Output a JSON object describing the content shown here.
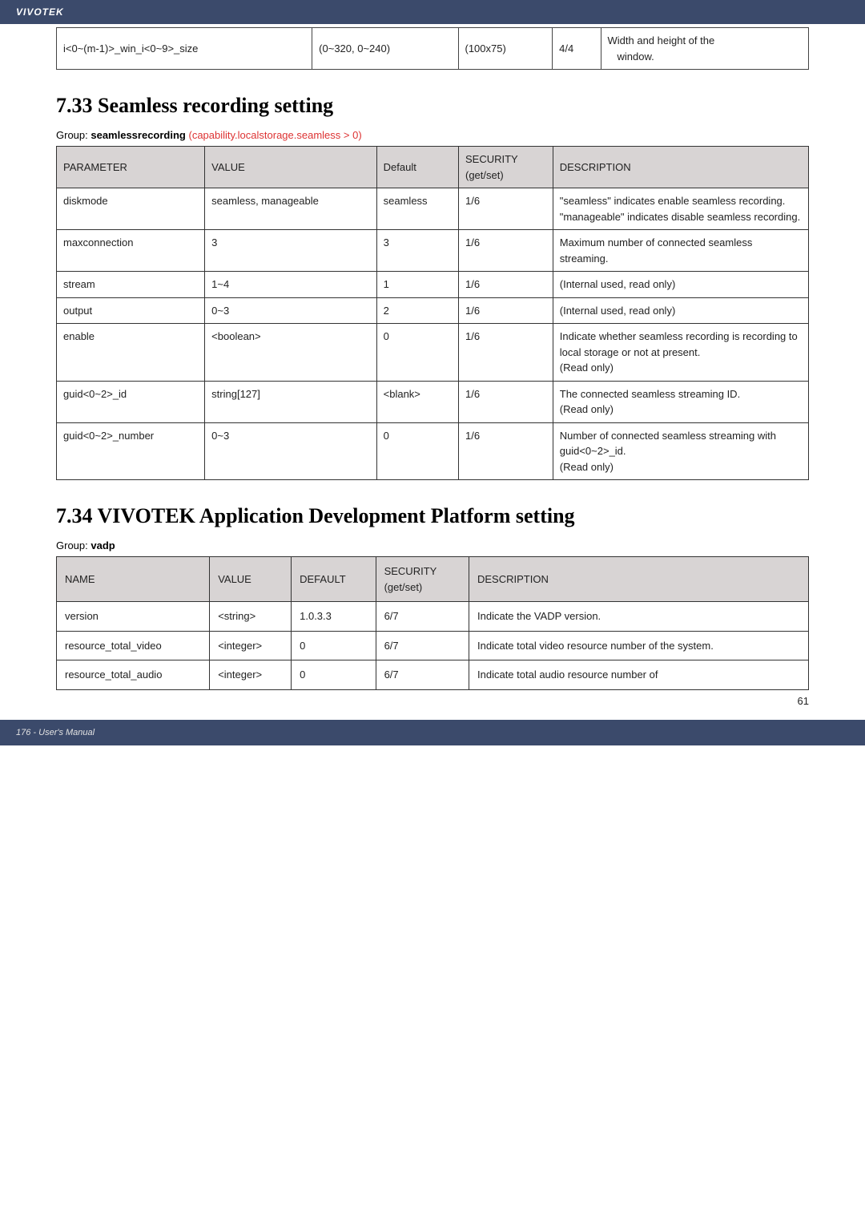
{
  "header": {
    "brand": "VIVOTEK"
  },
  "topTable": {
    "r": {
      "c0": "i<0~(m-1)>_win_i<0~9>_size",
      "c1": "(0~320, 0~240)",
      "c2": "(100x75)",
      "c3": "4/4",
      "c4a": "Width and height of the",
      "c4b": "window."
    }
  },
  "section1": {
    "heading": "7.33 Seamless recording setting",
    "groupPrefix": "Group: ",
    "groupName": "seamlessrecording",
    "groupSuffix": " (capability.localstorage.seamless > 0)",
    "headers": {
      "parameter": "PARAMETER",
      "value": "VALUE",
      "default": "Default",
      "security": "SECURITY",
      "getset": "(get/set)",
      "description": "DESCRIPTION"
    },
    "rows": [
      {
        "parameter": "diskmode",
        "value": "seamless, manageable",
        "default": "seamless",
        "security": "1/6",
        "desc": "\"seamless\" indicates enable seamless recording.\n\"manageable\" indicates disable seamless recording."
      },
      {
        "parameter": "maxconnection",
        "value": "3",
        "default": "3",
        "security": "1/6",
        "desc": "Maximum number of connected seamless streaming."
      },
      {
        "parameter": "stream",
        "value": "1~4",
        "default": "1",
        "security": "1/6",
        "desc": "(Internal used, read only)"
      },
      {
        "parameter": "output",
        "value": "0~3",
        "default": "2",
        "security": "1/6",
        "desc": "(Internal used, read only)"
      },
      {
        "parameter": "enable",
        "value": "<boolean>",
        "default": "0",
        "security": "1/6",
        "desc": "Indicate whether seamless recording is recording to local storage or not at present.\n(Read only)"
      },
      {
        "parameter": "guid<0~2>_id",
        "value": "string[127]",
        "default": "<blank>",
        "security": "1/6",
        "desc": "The connected seamless streaming ID.\n(Read only)"
      },
      {
        "parameter": "guid<0~2>_number",
        "value": "0~3",
        "default": "0",
        "security": "1/6",
        "desc": "Number of connected seamless streaming with guid<0~2>_id.\n(Read only)"
      }
    ]
  },
  "section2": {
    "heading": "7.34 VIVOTEK Application Development Platform setting",
    "groupPrefix": "Group: ",
    "groupName": "vadp",
    "headers": {
      "name": "NAME",
      "value": "VALUE",
      "default": "DEFAULT",
      "security": "SECURITY",
      "getset": "(get/set)",
      "description": "DESCRIPTION"
    },
    "rows": [
      {
        "name": "version",
        "value": "<string>",
        "default": "1.0.3.3",
        "security": "6/7",
        "desc": "Indicate the VADP version."
      },
      {
        "name": "resource_total_video",
        "value": "<integer>",
        "default": "0",
        "security": "6/7",
        "desc": "Indicate total video resource number of the system."
      },
      {
        "name": "resource_total_audio",
        "value": "<integer>",
        "default": "0",
        "security": "6/7",
        "desc": "Indicate total audio resource number of"
      }
    ]
  },
  "pagenum": "61",
  "footer": "176 - User's Manual"
}
